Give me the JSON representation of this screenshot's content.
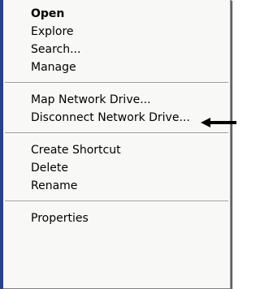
{
  "context_menu": {
    "groups": [
      {
        "items": [
          {
            "label": "Open"
          },
          {
            "label": "Explore"
          },
          {
            "label": "Search..."
          },
          {
            "label": "Manage"
          }
        ]
      },
      {
        "items": [
          {
            "label": "Map Network Drive..."
          },
          {
            "label": "Disconnect Network Drive..."
          }
        ]
      },
      {
        "items": [
          {
            "label": "Create Shortcut"
          },
          {
            "label": "Delete"
          },
          {
            "label": "Rename"
          }
        ]
      },
      {
        "items": [
          {
            "label": "Properties"
          }
        ]
      }
    ]
  },
  "annotation": {
    "icon": "arrow-left-icon",
    "color": "#000000"
  }
}
